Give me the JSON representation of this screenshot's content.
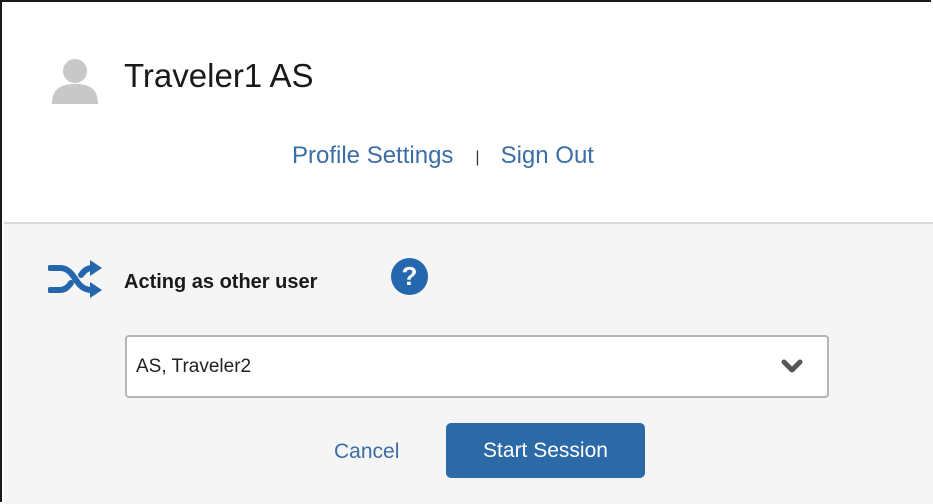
{
  "profile": {
    "user_name": "Traveler1 AS",
    "avatar_icon": "user-avatar-icon",
    "links": {
      "profile_settings": "Profile Settings",
      "separator": "|",
      "sign_out": "Sign Out"
    }
  },
  "proxy": {
    "icon": "shuffle-icon",
    "title": "Acting as other user",
    "help_icon": "question-circle-icon",
    "help_glyph": "?",
    "select": {
      "selected_value": "AS, Traveler2",
      "chevron_icon": "chevron-down-icon"
    },
    "cancel_label": "Cancel",
    "start_label": "Start Session"
  },
  "colors": {
    "link": "#3a6ea5",
    "accent": "#2467ae",
    "button": "#2c69a7",
    "panel_background": "#f5f5f5"
  }
}
